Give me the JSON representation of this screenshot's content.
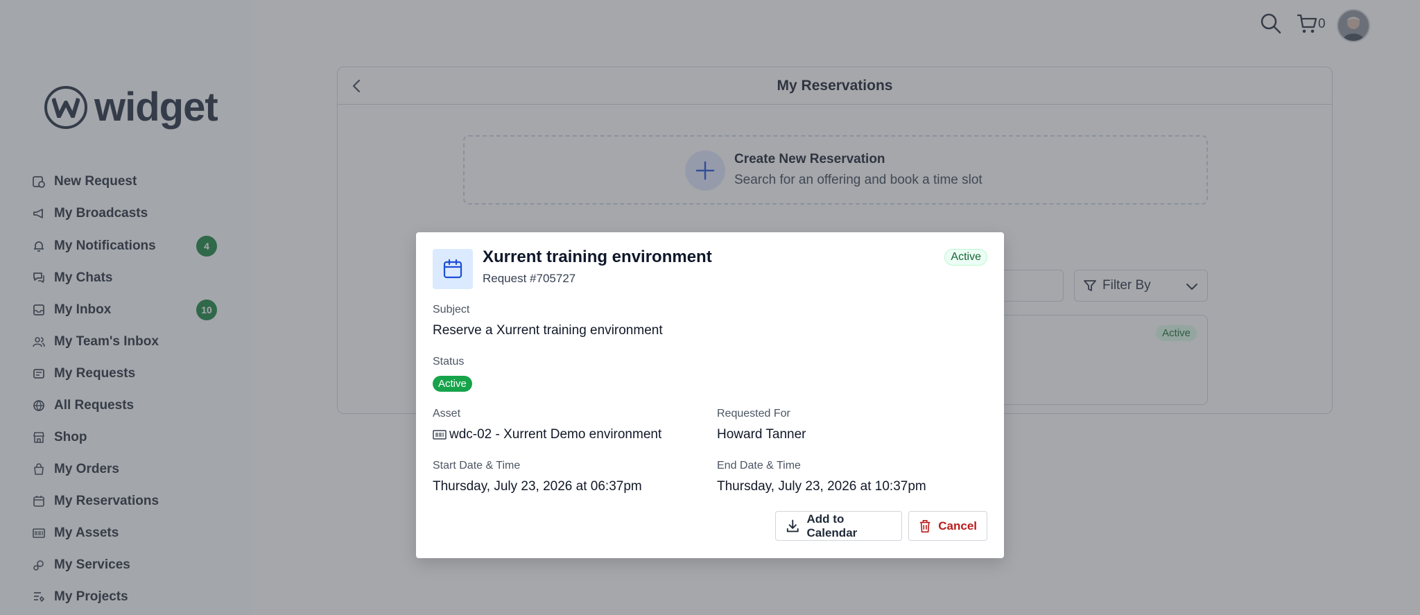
{
  "app": {
    "brand": "widget"
  },
  "header": {
    "cart_count": "0"
  },
  "sidebar": {
    "items": [
      {
        "label": "New Request",
        "icon": "new-request-icon",
        "badge": null
      },
      {
        "label": "My Broadcasts",
        "icon": "megaphone-icon",
        "badge": null
      },
      {
        "label": "My Notifications",
        "icon": "bell-icon",
        "badge": "4"
      },
      {
        "label": "My Chats",
        "icon": "chat-icon",
        "badge": null
      },
      {
        "label": "My Inbox",
        "icon": "inbox-icon",
        "badge": "10"
      },
      {
        "label": "My Team's Inbox",
        "icon": "team-icon",
        "badge": null
      },
      {
        "label": "My Requests",
        "icon": "requests-icon",
        "badge": null
      },
      {
        "label": "All Requests",
        "icon": "globe-icon",
        "badge": null
      },
      {
        "label": "Shop",
        "icon": "store-icon",
        "badge": null
      },
      {
        "label": "My Orders",
        "icon": "shopping-bag-icon",
        "badge": null
      },
      {
        "label": "My Reservations",
        "icon": "calendar-icon",
        "badge": null
      },
      {
        "label": "My Assets",
        "icon": "barcode-icon",
        "badge": null
      },
      {
        "label": "My Services",
        "icon": "services-icon",
        "badge": null
      },
      {
        "label": "My Projects",
        "icon": "projects-icon",
        "badge": null
      }
    ]
  },
  "main": {
    "title": "My Reservations",
    "create": {
      "title": "Create New Reservation",
      "subtitle": "Search for an offering and book a time slot"
    },
    "filter_label": "Filter By",
    "card_status": "Active"
  },
  "modal": {
    "title": "Xurrent training environment",
    "request_number": "Request #705727",
    "status_badge": "Active",
    "subject_label": "Subject",
    "subject_value": "Reserve a Xurrent training environment",
    "status_label": "Status",
    "status_value": "Active",
    "asset_label": "Asset",
    "asset_value": "wdc-02 - Xurrent Demo environment",
    "requested_for_label": "Requested For",
    "requested_for_value": "Howard Tanner",
    "start_label": "Start Date & Time",
    "start_value": "Thursday, July 23, 2026 at 06:37pm",
    "end_label": "End Date & Time",
    "end_value": "Thursday, July 23, 2026 at 10:37pm",
    "add_to_calendar": "Add to Calendar",
    "cancel": "Cancel"
  },
  "colors": {
    "status_green": "#16a34a",
    "badge_bg": "#dcfce7",
    "accent_blue": "#1d4ed8",
    "cancel_red": "#b91c1c",
    "overlay": "#4b5058"
  }
}
